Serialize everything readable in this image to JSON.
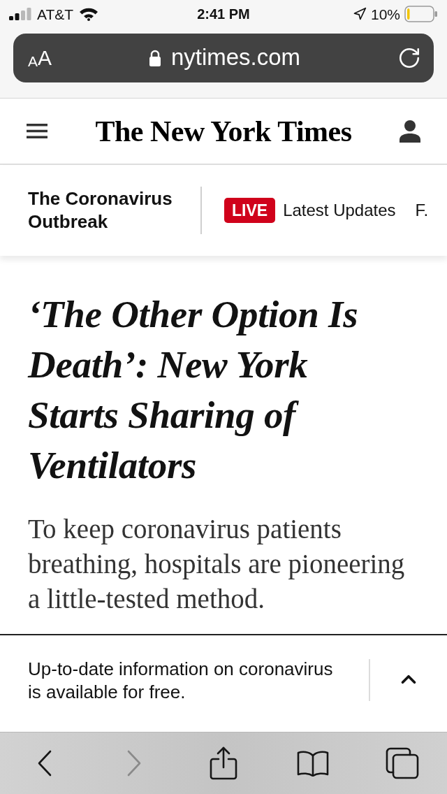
{
  "status_bar": {
    "carrier": "AT&T",
    "time": "2:41 PM",
    "battery_percent": "10%",
    "battery": {
      "level": 0.1
    }
  },
  "address_bar": {
    "format_button": "AA",
    "domain": "nytimes.com"
  },
  "masthead": {
    "logo": "The New York Times"
  },
  "section_nav": {
    "title": "The Coronavirus Outbreak",
    "items": [
      {
        "badge": "LIVE",
        "label": "Latest Updates"
      },
      {
        "label": "F."
      }
    ]
  },
  "article": {
    "headline": "‘The Other Option Is Death’: New York Starts Sharing of Ventilators",
    "summary": "To keep coronavirus patients breathing, hospitals are pioneering a little-tested method."
  },
  "banner": {
    "message": "Up-to-date information on coronavirus is available for free.",
    "expanded": false
  },
  "toolbar": [
    {
      "kind": "back",
      "disabled": false
    },
    {
      "kind": "forward",
      "disabled": true
    },
    {
      "kind": "share",
      "disabled": false
    },
    {
      "kind": "bookmarks",
      "disabled": false
    },
    {
      "kind": "tabs",
      "disabled": false
    }
  ]
}
